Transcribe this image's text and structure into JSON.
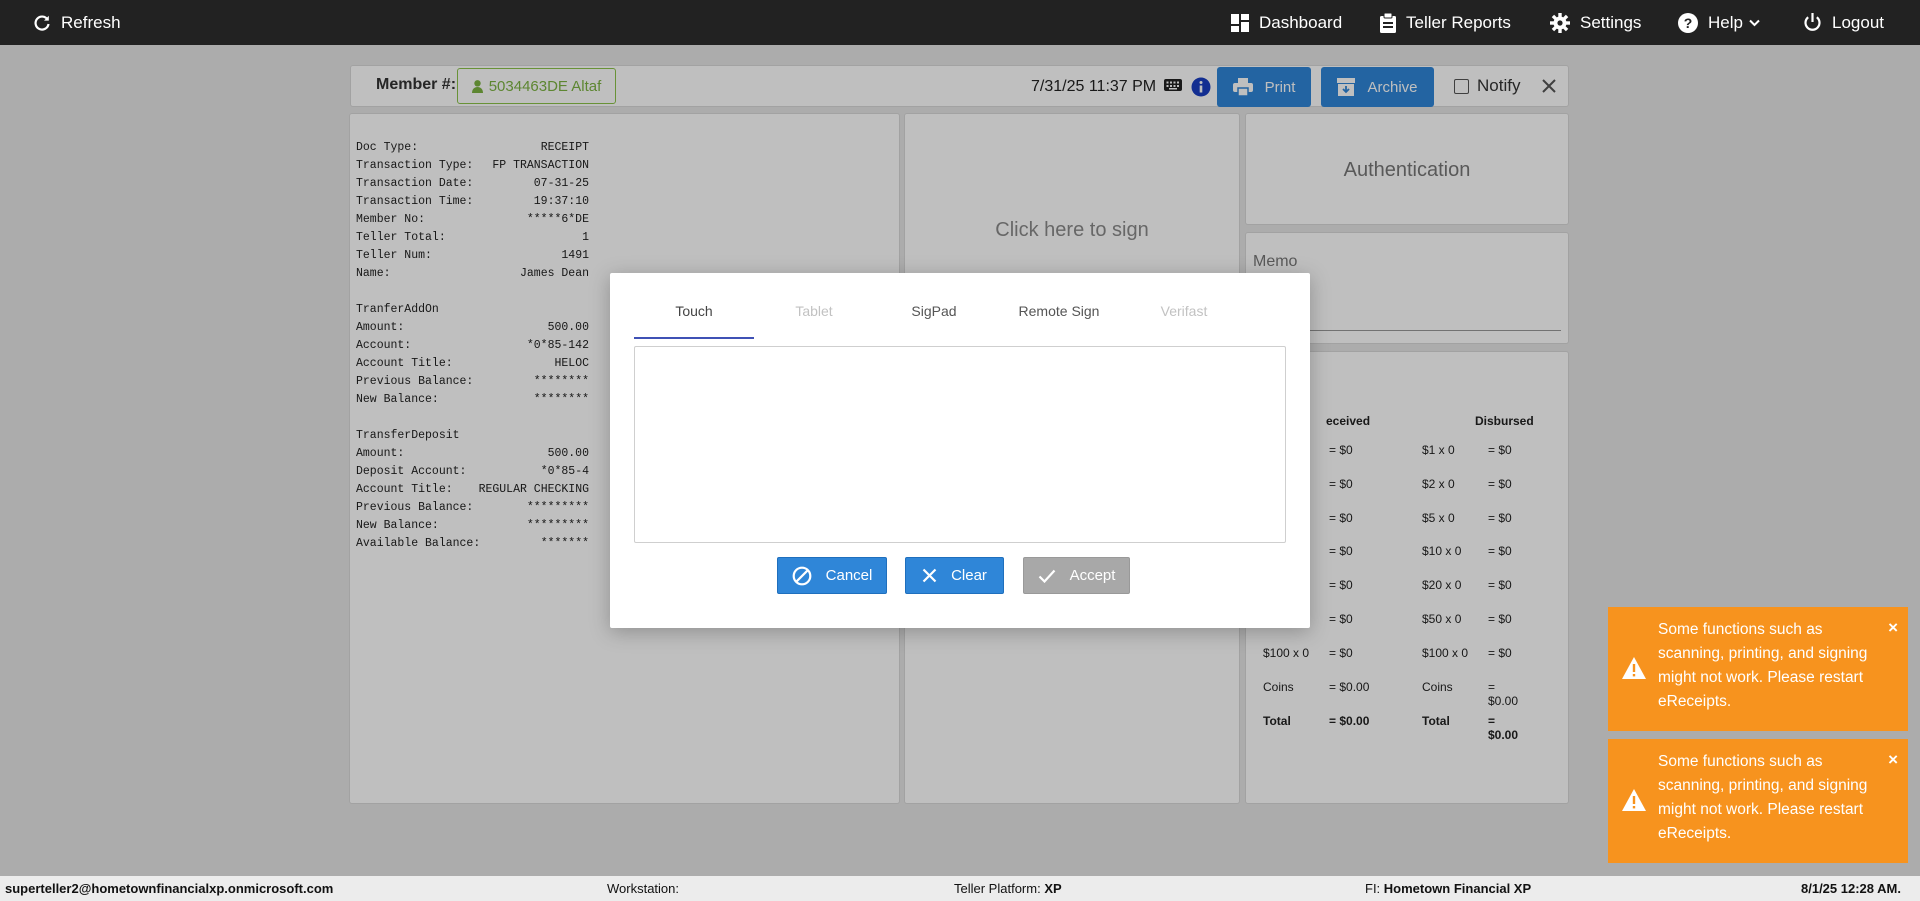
{
  "topbar": {
    "refresh": "Refresh",
    "dashboard": "Dashboard",
    "teller_reports": "Teller Reports",
    "settings": "Settings",
    "help": "Help",
    "logout": "Logout"
  },
  "header": {
    "member_label": "Member #:",
    "member_value": "5034463DE Altaf",
    "datetime": "7/31/25 11:37 PM",
    "print": "Print",
    "archive": "Archive",
    "notify": "Notify"
  },
  "receipt": {
    "rows": [
      [
        "Doc Type:",
        "RECEIPT"
      ],
      [
        "Transaction Type:",
        "FP TRANSACTION"
      ],
      [
        "Transaction Date:",
        "07-31-25"
      ],
      [
        "Transaction Time:",
        "19:37:10"
      ],
      [
        "Member No:",
        "*****6*DE"
      ],
      [
        "Teller Total:",
        "1"
      ],
      [
        "Teller Num:",
        "1491"
      ],
      [
        "Name:",
        "James Dean"
      ],
      [
        "",
        ""
      ],
      [
        "TranferAddOn",
        ""
      ],
      [
        "Amount:",
        "500.00"
      ],
      [
        "Account:",
        "*0*85-142"
      ],
      [
        "Account Title:",
        "HELOC"
      ],
      [
        "Previous Balance:",
        "********"
      ],
      [
        "New Balance:",
        "********"
      ],
      [
        "",
        ""
      ],
      [
        "TransferDeposit",
        ""
      ],
      [
        "Amount:",
        "500.00"
      ],
      [
        "Deposit Account:",
        "*0*85-4"
      ],
      [
        "Account Title:",
        "REGULAR CHECKING"
      ],
      [
        "Previous Balance:",
        "*********"
      ],
      [
        "New Balance:",
        "*********"
      ],
      [
        "Available Balance:",
        "*******"
      ]
    ]
  },
  "sign_panel": {
    "prompt": "Click here to sign"
  },
  "auth_panel": {
    "title": "Authentication"
  },
  "memo_panel": {
    "label": "Memo"
  },
  "cash": {
    "received_header": "eceived",
    "disbursed_header": "Disbursed",
    "received": [
      [
        "",
        "= $0"
      ],
      [
        "",
        "= $0"
      ],
      [
        "",
        "= $0"
      ],
      [
        "",
        "= $0"
      ],
      [
        "",
        "= $0"
      ],
      [
        "",
        "= $0"
      ],
      [
        "$100 x 0",
        "= $0"
      ],
      [
        "Coins",
        "= $0.00"
      ],
      [
        "Total",
        "= $0.00"
      ]
    ],
    "disbursed": [
      [
        "$1 x 0",
        "= $0"
      ],
      [
        "$2 x 0",
        "= $0"
      ],
      [
        "$5 x 0",
        "= $0"
      ],
      [
        "$10 x 0",
        "= $0"
      ],
      [
        "$20 x 0",
        "= $0"
      ],
      [
        "$50 x 0",
        "= $0"
      ],
      [
        "$100 x 0",
        "= $0"
      ],
      [
        "Coins",
        "= $0.00"
      ],
      [
        "Total",
        "= $0.00"
      ]
    ]
  },
  "modal": {
    "tabs": [
      "Touch",
      "Tablet",
      "SigPad",
      "Remote Sign",
      "Verifast"
    ],
    "cancel": "Cancel",
    "clear": "Clear",
    "accept": "Accept"
  },
  "toasts": [
    {
      "message": "Some functions such as scanning, printing, and signing might not work. Please restart eReceipts."
    },
    {
      "message": "Some functions such as scanning, printing, and signing might not work. Please restart eReceipts."
    }
  ],
  "footer": {
    "user": "superteller2@hometownfinancialxp.onmicrosoft.com",
    "workstation_label": "Workstation:",
    "workstation_value": "",
    "platform_label": "Teller Platform:",
    "platform_value": "XP",
    "fi_label": "FI:",
    "fi_value": "Hometown Financial XP",
    "datetime": "8/1/25 12:28 AM."
  },
  "colors": {
    "topbar": "#222222",
    "primary_button": "#2f86d8",
    "member_green": "#7cb342",
    "toast_orange": "#f7931e",
    "active_tab": "#3f51b5"
  }
}
